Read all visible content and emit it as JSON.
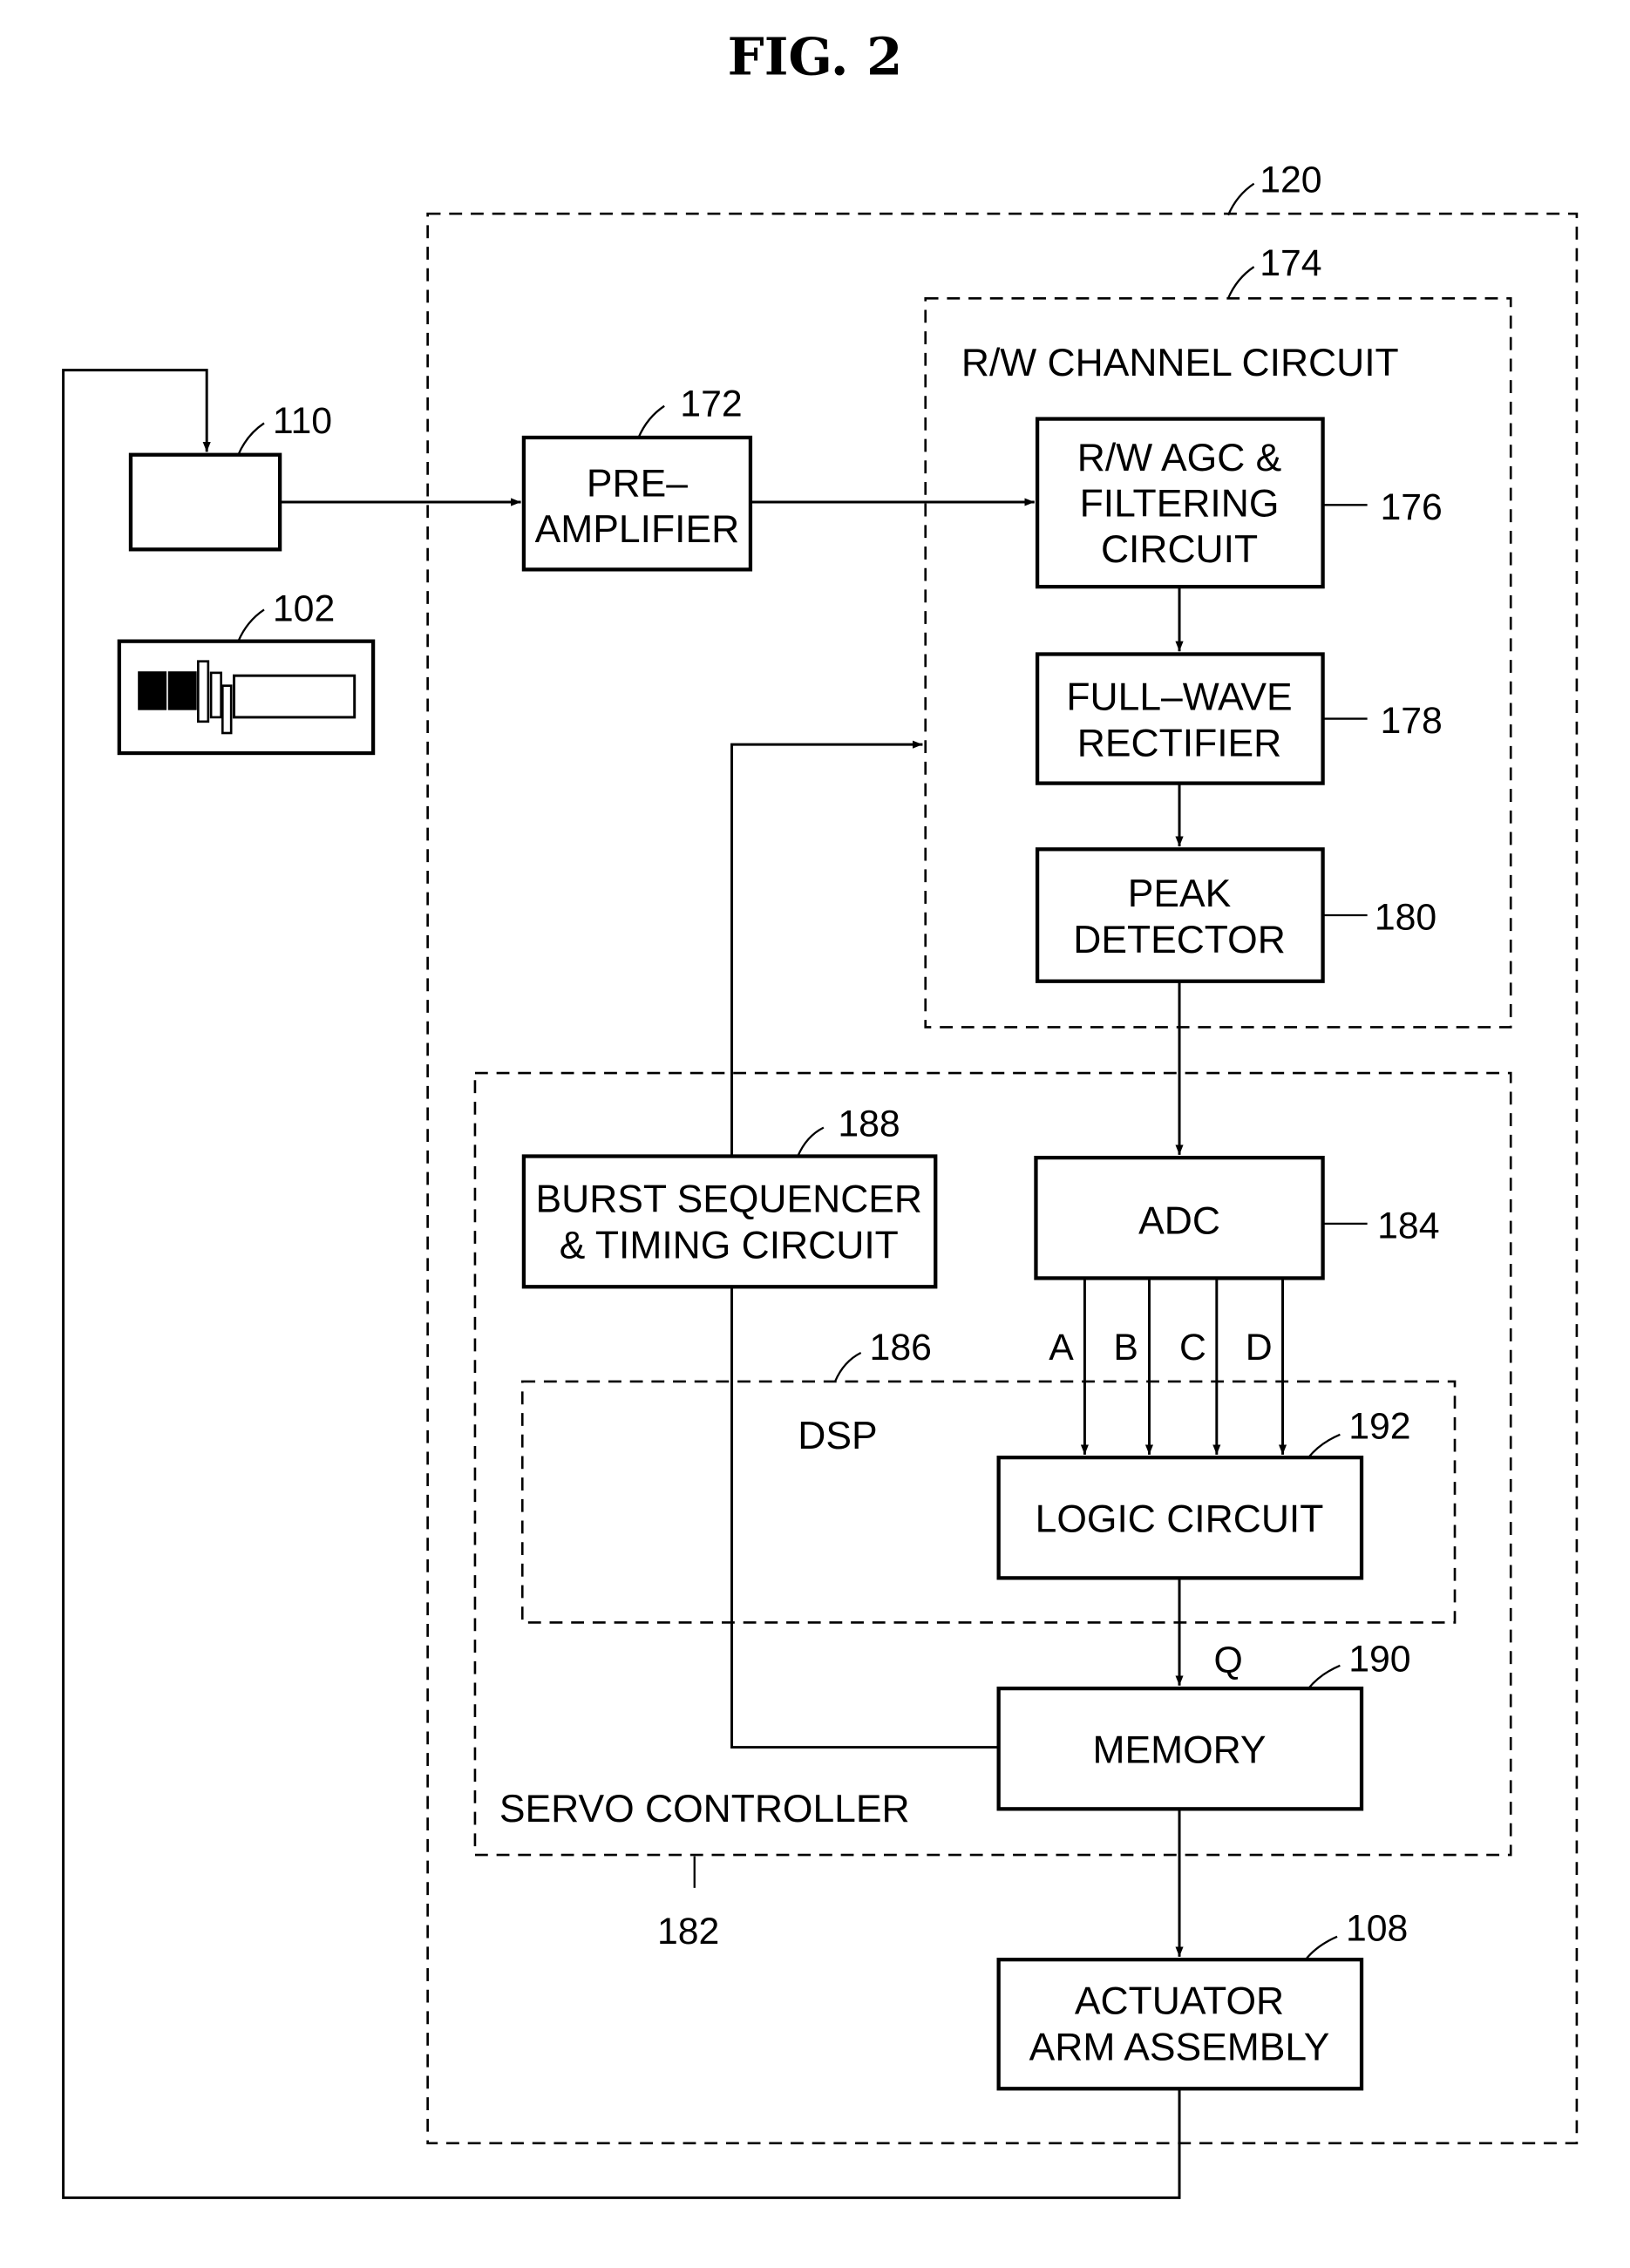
{
  "figure": {
    "title": "FIG. 2"
  },
  "containers": {
    "controller": {
      "ref": "120"
    },
    "rw_channel": {
      "ref": "174",
      "label": "R/W CHANNEL CIRCUIT"
    },
    "servo": {
      "ref": "182",
      "label": "SERVO CONTROLLER"
    },
    "dsp": {
      "ref": "186",
      "label": "DSP"
    }
  },
  "blocks": {
    "head": {
      "ref": "110"
    },
    "disk": {
      "ref": "102"
    },
    "preamp": {
      "ref": "172",
      "line1": "PRE–",
      "line2": "AMPLIFIER"
    },
    "agc": {
      "ref": "176",
      "line1": "R/W AGC &",
      "line2": "FILTERING",
      "line3": "CIRCUIT"
    },
    "rectifier": {
      "ref": "178",
      "line1": "FULL–WAVE",
      "line2": "RECTIFIER"
    },
    "peak": {
      "ref": "180",
      "line1": "PEAK",
      "line2": "DETECTOR"
    },
    "adc": {
      "ref": "184",
      "label": "ADC"
    },
    "burst": {
      "ref": "188",
      "line1": "BURST SEQUENCER",
      "line2": "& TIMING CIRCUIT"
    },
    "logic": {
      "ref": "192",
      "label": "LOGIC CIRCUIT"
    },
    "memory": {
      "ref": "190",
      "label": "MEMORY"
    },
    "actuator": {
      "ref": "108",
      "line1": "ACTUATOR",
      "line2": "ARM ASSEMBLY"
    }
  },
  "signals": {
    "a": "A",
    "b": "B",
    "c": "C",
    "d": "D",
    "q": "Q"
  }
}
